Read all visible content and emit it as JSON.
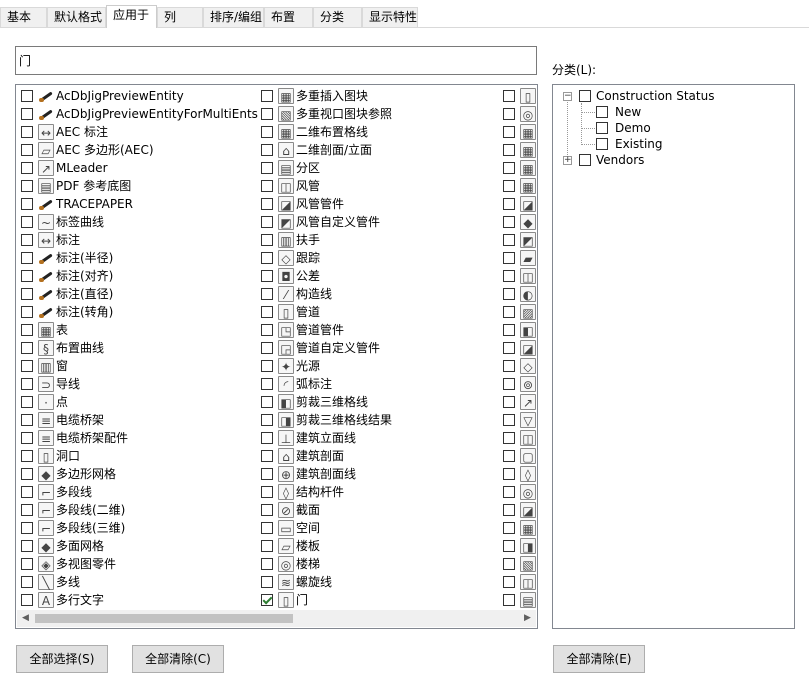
{
  "tabs": [
    "基本",
    "默认格式",
    "应用于",
    "列",
    "排序/编组",
    "布置",
    "分类",
    "显示特性"
  ],
  "filter": {
    "value": "门"
  },
  "col1": [
    "AcDbJigPreviewEntity",
    "AcDbJigPreviewEntityForMultiEnts",
    "AEC 标注",
    "AEC 多边形(AEC)",
    "MLeader",
    "PDF 参考底图",
    "TRACEPAPER",
    "标签曲线",
    "标注",
    "标注(半径)",
    "标注(对齐)",
    "标注(直径)",
    "标注(转角)",
    "表",
    "布置曲线",
    "窗",
    "导线",
    "点",
    "电缆桥架",
    "电缆桥架配件",
    "洞口",
    "多边形网格",
    "多段线",
    "多段线(二维)",
    "多段线(三维)",
    "多面网格",
    "多视图零件",
    "多线",
    "多行文字"
  ],
  "col2": [
    "多重插入图块",
    "多重视口图块参照",
    "二维布置格线",
    "二维剖面/立面",
    "分区",
    "风管",
    "风管管件",
    "风管自定义管件",
    "扶手",
    "跟踪",
    "公差",
    "构造线",
    "管道",
    "管道管件",
    "管道自定义管件",
    "光源",
    "弧标注",
    "剪裁三维格线",
    "剪裁三维格线结果",
    "建筑立面线",
    "建筑剖面",
    "建筑剖面线",
    "结构杆件",
    "截面",
    "空间",
    "楼板",
    "楼梯",
    "螺旋线",
    "门"
  ],
  "col2_checked": "门",
  "col1_icons": [
    "brush",
    "brush",
    "dim",
    "poly",
    "leader",
    "pdf",
    "brush",
    "tag",
    "dim",
    "brush",
    "brush",
    "brush",
    "brush",
    "table",
    "curve",
    "window",
    "wire",
    "point",
    "tray",
    "tray",
    "opening",
    "mesh",
    "pline",
    "pline",
    "pline",
    "mesh",
    "part",
    "mline",
    "text"
  ],
  "category_label": "分类(L):",
  "tree": {
    "root": "Construction Status",
    "children": [
      "New",
      "Demo",
      "Existing"
    ],
    "other": "Vendors"
  },
  "buttons": {
    "select_all": "全部选择(S)",
    "clear_all": "全部清除(C)",
    "clear_all_cat": "全部清除(E)"
  }
}
